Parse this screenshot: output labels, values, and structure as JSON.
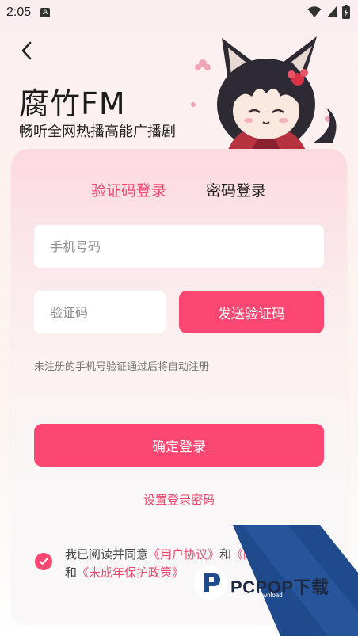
{
  "status_bar": {
    "time": "2:05",
    "notification_letter": "A"
  },
  "header": {
    "title": "腐竹FM",
    "subtitle": "畅听全网热播高能广播剧"
  },
  "tabs": [
    {
      "label": "验证码登录",
      "active": true
    },
    {
      "label": "密码登录",
      "active": false
    }
  ],
  "form": {
    "phone_placeholder": "手机号码",
    "code_placeholder": "验证码",
    "send_code_label": "发送验证码",
    "hint": "未注册的手机号验证通过后将自动注册",
    "login_label": "确定登录",
    "set_password_label": "设置登录密码"
  },
  "agreement": {
    "checked": true,
    "prefix": "我已阅读并同意",
    "user_agreement": "《用户协议》",
    "and1": "和",
    "privacy_partial": "《隐",
    "and2": "和",
    "minor_policy": "《未成年保护政策》"
  },
  "watermark": {
    "brand": "PCPOP下载",
    "sub": "PCPOP Download"
  },
  "colors": {
    "accent": "#fb4772",
    "accent_text": "#f0476d"
  }
}
